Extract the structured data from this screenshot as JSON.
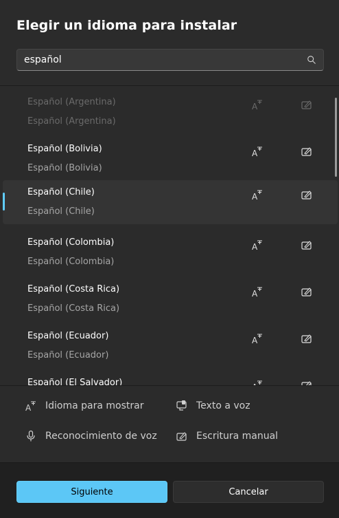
{
  "dialog": {
    "title": "Elegir un idioma para instalar"
  },
  "search": {
    "value": "español",
    "placeholder": ""
  },
  "languages": [
    {
      "name": "Español (Argentina)",
      "native": "Español (Argentina)",
      "state": "disabled"
    },
    {
      "name": "Español (Bolivia)",
      "native": "Español (Bolivia)",
      "state": "normal"
    },
    {
      "name": "Español (Chile)",
      "native": "Español (Chile)",
      "state": "selected"
    },
    {
      "name": "Español (Colombia)",
      "native": "Español (Colombia)",
      "state": "normal"
    },
    {
      "name": "Español (Costa Rica)",
      "native": "Español (Costa Rica)",
      "state": "normal"
    },
    {
      "name": "Español (Ecuador)",
      "native": "Español (Ecuador)",
      "state": "normal"
    },
    {
      "name": "Español (El Salvador)",
      "native": "",
      "state": "normal"
    }
  ],
  "features_legend": {
    "display_language": "Idioma para mostrar",
    "text_to_speech": "Texto a voz",
    "speech_recognition": "Reconocimiento de voz",
    "handwriting": "Escritura manual"
  },
  "footer": {
    "next_label": "Siguiente",
    "cancel_label": "Cancelar"
  },
  "colors": {
    "accent": "#5cc7f6",
    "selection_indicator": "#60cdff",
    "background": "#2b2b2b",
    "footer_background": "#202020"
  },
  "icons": {
    "search": "search-icon",
    "display_language": "display-language-icon",
    "text_to_speech": "text-to-speech-icon",
    "speech_recognition": "microphone-icon",
    "handwriting": "handwriting-icon"
  }
}
